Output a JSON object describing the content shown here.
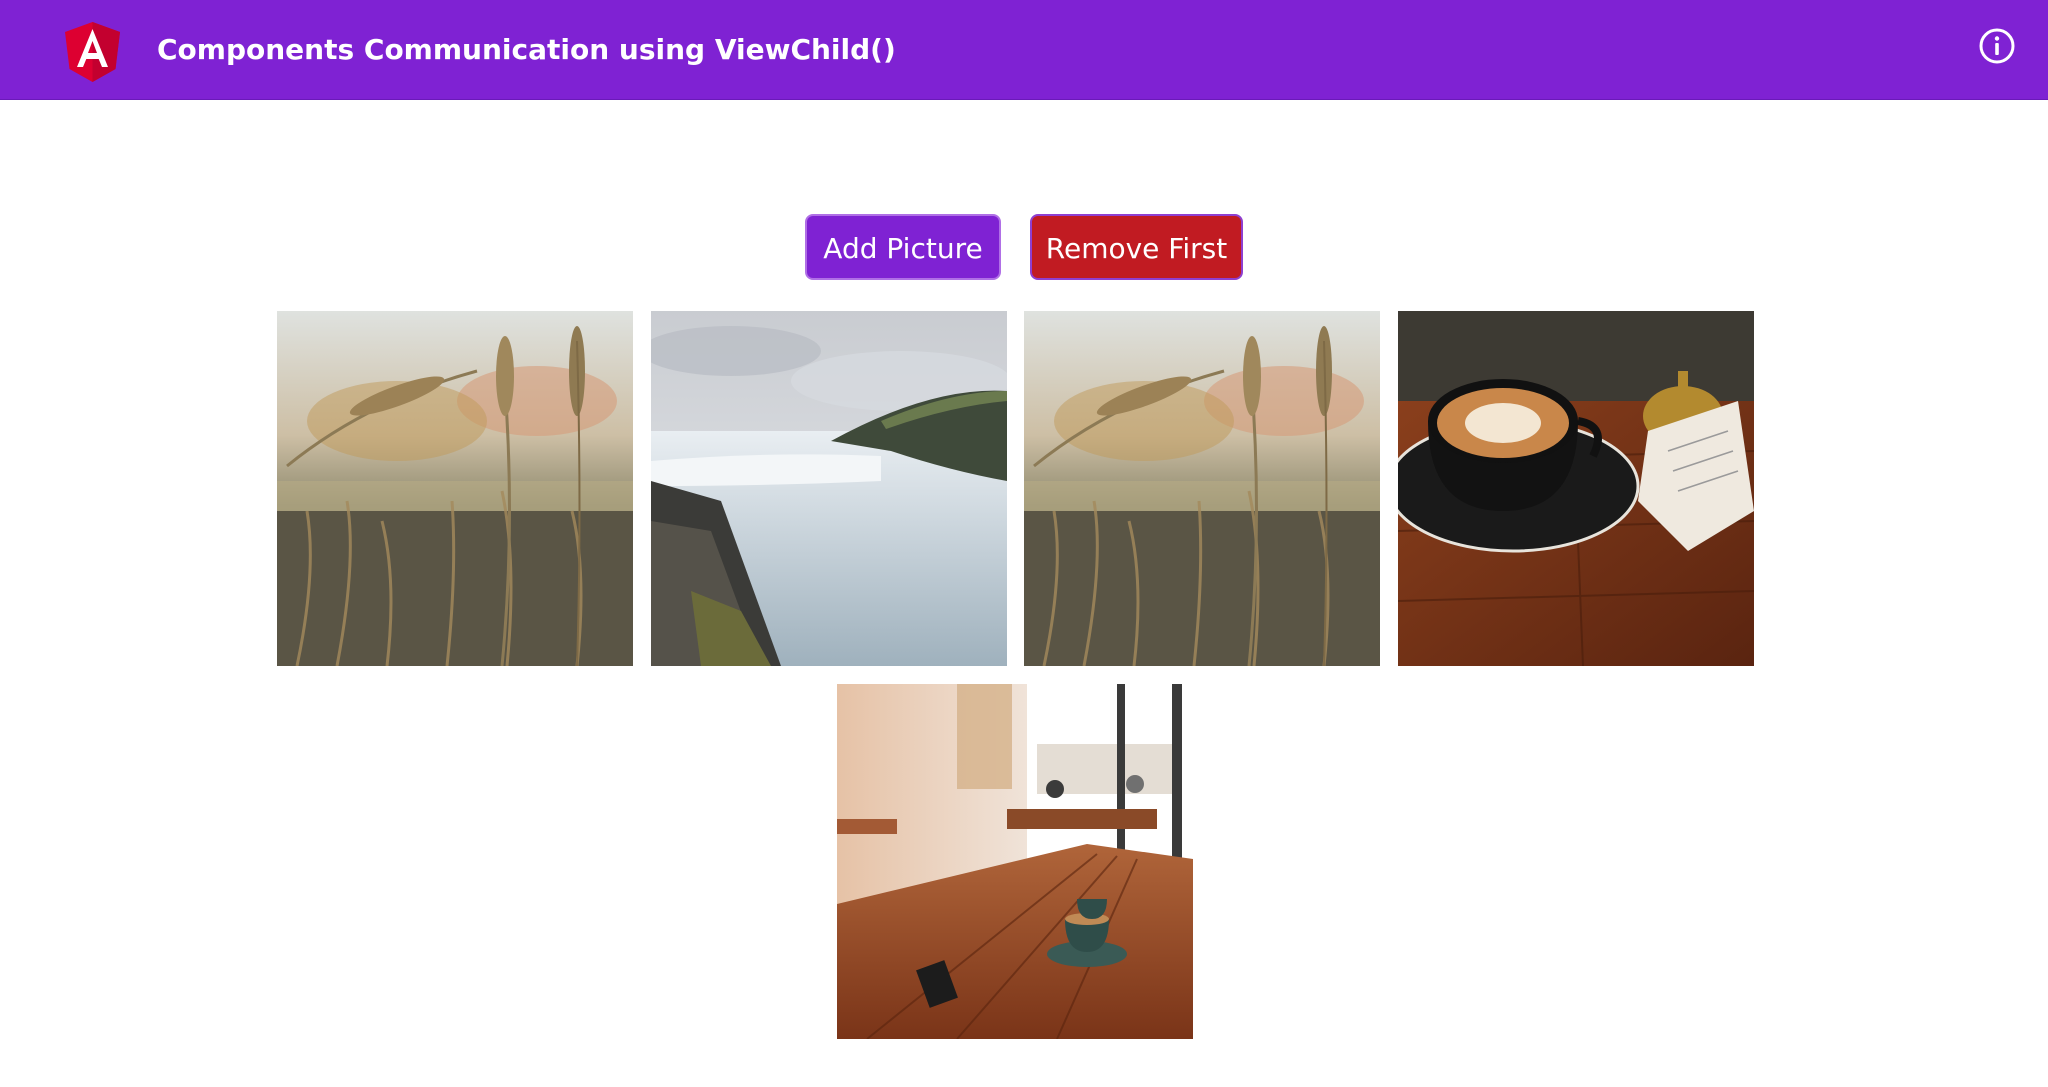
{
  "header": {
    "title": "Components Communication using ViewChild()",
    "logo_icon": "angular-logo",
    "info_icon": "info-circle-icon",
    "background_color": "#7f22d3"
  },
  "actions": {
    "add_label": "Add Picture",
    "remove_label": "Remove First",
    "add_color": "#7f22d3",
    "remove_color": "#c11b22"
  },
  "gallery": {
    "pictures": [
      {
        "subject": "wheat-field"
      },
      {
        "subject": "waterfall"
      },
      {
        "subject": "wheat-field"
      },
      {
        "subject": "latte-coffee-on-table"
      },
      {
        "subject": "cafe-interior-table"
      }
    ]
  }
}
